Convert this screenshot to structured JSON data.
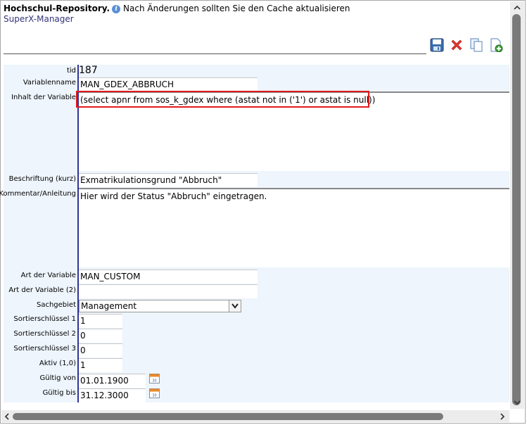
{
  "header": {
    "title": "Hochschul-Repository.",
    "info_icon": "info-icon",
    "message": "Nach Änderungen sollten Sie den Cache aktualisieren",
    "link": "SuperX-Manager"
  },
  "toolbar": {
    "icons": [
      "save-icon",
      "delete-icon",
      "copy-icon",
      "new-icon"
    ]
  },
  "form": {
    "tid_label": "tid",
    "tid_value": "187",
    "variablenname_label": "Variablenname",
    "variablenname_value": "MAN_GDEX_ABBRUCH",
    "inhalt_label": "Inhalt der Variable",
    "inhalt_value": "(select apnr from sos_k_gdex where (astat not in ('1') or astat is null))",
    "beschriftung_label": "Beschriftung (kurz)",
    "beschriftung_value": "Exmatrikulationsgrund \"Abbruch\"",
    "kommentar_label": "Kommentar/Anleitung",
    "kommentar_value": "Hier wird der Status \"Abbruch\" eingetragen.",
    "art_label": "Art der Variable",
    "art_value": "MAN_CUSTOM",
    "art2_label": "Art der Variable (2)",
    "art2_value": "",
    "sachgebiet_label": "Sachgebiet",
    "sachgebiet_value": "Management",
    "sort1_label": "Sortierschlüssel 1",
    "sort1_value": "1",
    "sort2_label": "Sortierschlüssel 2",
    "sort2_value": "0",
    "sort3_label": "Sortierschlüssel 3",
    "sort3_value": "0",
    "aktiv_label": "Aktiv (1,0)",
    "aktiv_value": "1",
    "gueltig_von_label": "Gültig von",
    "gueltig_von_value": "01.01.1900",
    "gueltig_bis_label": "Gültig bis",
    "gueltig_bis_value": "31.12.3000"
  },
  "colors": {
    "highlight_box": "#e21b1b",
    "form_background": "#eef5fc",
    "label_divider": "#333399"
  }
}
